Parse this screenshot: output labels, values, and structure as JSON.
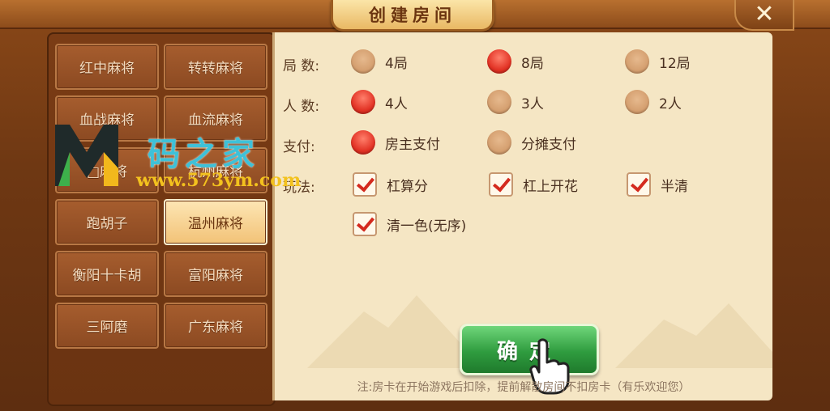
{
  "title": "创建房间",
  "close_label": "✕",
  "games": [
    {
      "label": "红中麻将"
    },
    {
      "label": "转转麻将"
    },
    {
      "label": "血战麻将"
    },
    {
      "label": "血流麻将"
    },
    {
      "label": "□麻将"
    },
    {
      "label": "杭州麻将"
    },
    {
      "label": "跑胡子"
    },
    {
      "label": "温州麻将",
      "active": true
    },
    {
      "label": "衡阳十卡胡"
    },
    {
      "label": "富阳麻将"
    },
    {
      "label": "三阿磨"
    },
    {
      "label": "广东麻将"
    }
  ],
  "settings": {
    "rounds": {
      "label": "局  数:",
      "options": [
        "4局",
        "8局",
        "12局"
      ],
      "selected": "8局"
    },
    "players": {
      "label": "人  数:",
      "options": [
        "4人",
        "3人",
        "2人"
      ],
      "selected": "4人"
    },
    "payment": {
      "label": "支付:",
      "options": [
        "房主支付",
        "分摊支付"
      ],
      "selected": "房主支付"
    },
    "rules": {
      "label": "玩法:",
      "options": [
        "杠算分",
        "杠上开花",
        "半清",
        "清一色(无序)"
      ],
      "checked": [
        "杠算分",
        "杠上开花",
        "半清",
        "清一色(无序)"
      ]
    }
  },
  "confirm_label": "确定",
  "note": "注:房卡在开始游戏后扣除，提前解散房间不扣房卡（有乐欢迎您）",
  "watermark": {
    "title": "码之家",
    "url": "www.573ym.com"
  },
  "colors": {
    "selected_radio": "#e23325",
    "confirm": "#2f9c3f",
    "panel": "#f5e6c4"
  }
}
